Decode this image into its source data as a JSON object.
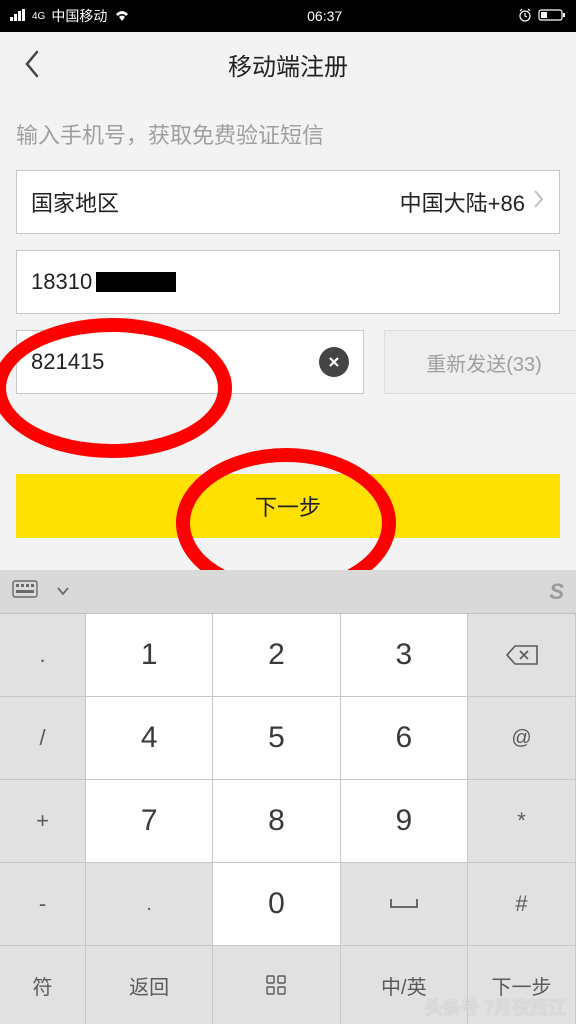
{
  "status": {
    "carrier_prefix": "4G",
    "carrier": "中国移动",
    "time": "06:37"
  },
  "header": {
    "title": "移动端注册"
  },
  "form": {
    "prompt": "输入手机号，获取免费验证短信",
    "region_label": "国家地区",
    "region_value": "中国大陆+86",
    "phone_prefix": "18310",
    "code_value": "821415",
    "resend_label": "重新发送(33)",
    "next_label": "下一步"
  },
  "keyboard": {
    "side_left": [
      ".",
      "/",
      "+",
      "-"
    ],
    "digits": [
      "1",
      "2",
      "3",
      "4",
      "5",
      "6",
      "7",
      "8",
      "9"
    ],
    "side_right_top": "",
    "side_right_at": "@",
    "side_right_star": "*",
    "side_right_hash": "#",
    "zero": "0",
    "dot": ".",
    "space": "",
    "sym": "符",
    "back": "返回",
    "next": "下一步"
  },
  "watermark": "头条号 7月夜西江"
}
